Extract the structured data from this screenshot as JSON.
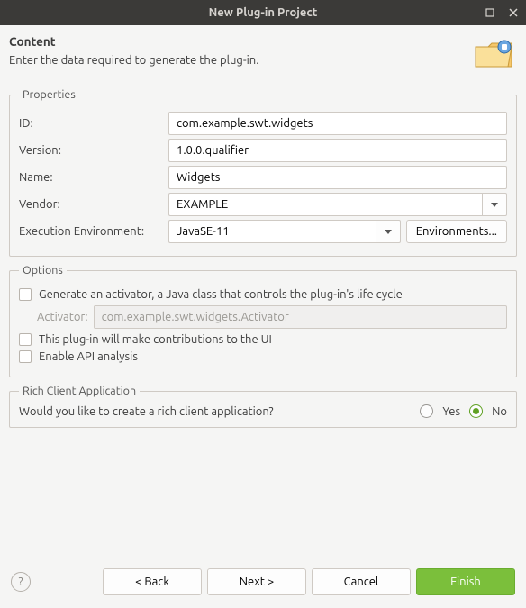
{
  "window": {
    "title": "New Plug-in Project"
  },
  "header": {
    "title": "Content",
    "subtitle": "Enter the data required to generate the plug-in."
  },
  "properties": {
    "legend": "Properties",
    "id_label": "ID:",
    "id_value": "com.example.swt.widgets",
    "version_label": "Version:",
    "version_value": "1.0.0.qualifier",
    "name_label": "Name:",
    "name_value": "Widgets",
    "vendor_label": "Vendor:",
    "vendor_value": "EXAMPLE",
    "exec_env_label": "Execution Environment:",
    "exec_env_value": "JavaSE-11",
    "environments_button": "Environments..."
  },
  "options": {
    "legend": "Options",
    "generate_activator_label": "Generate an activator, a Java class that controls the plug-in's life cycle",
    "activator_label": "Activator:",
    "activator_value": "com.example.swt.widgets.Activator",
    "ui_contributions_label": "This plug-in will make contributions to the UI",
    "enable_api_label": "Enable API analysis"
  },
  "rca": {
    "legend": "Rich Client Application",
    "question": "Would you like to create a rich client application?",
    "yes_label": "Yes",
    "no_label": "No"
  },
  "footer": {
    "back": "< Back",
    "next": "Next >",
    "cancel": "Cancel",
    "finish": "Finish"
  }
}
